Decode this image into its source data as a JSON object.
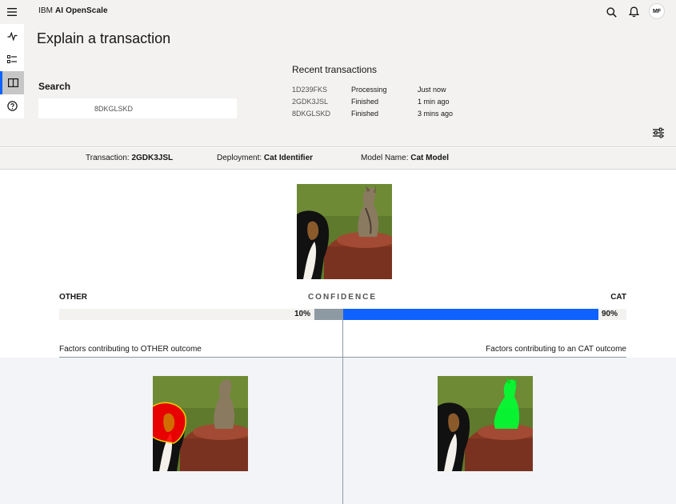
{
  "header": {
    "brand_ibm": "IBM",
    "brand_product": "AI OpenScale",
    "avatar_initials": "MF"
  },
  "page": {
    "title": "Explain a transaction"
  },
  "search": {
    "label": "Search",
    "value": "8DKGLSKD"
  },
  "recent": {
    "title": "Recent transactions",
    "rows": [
      {
        "id": "1D239FKS",
        "status": "Processing",
        "time": "Just now"
      },
      {
        "id": "2GDK3JSL",
        "status": "Finished",
        "time": "1 min ago"
      },
      {
        "id": "8DKGLSKD",
        "status": "Finished",
        "time": "3 mins ago"
      }
    ]
  },
  "info": {
    "transaction_label": "Transaction:",
    "transaction_value": "2GDK3JSL",
    "deployment_label": "Deployment:",
    "deployment_value": "Cat Identifier",
    "model_label": "Model Name:",
    "model_value": "Cat Model"
  },
  "confidence": {
    "left_label": "OTHER",
    "center_label": "CONFIDENCE",
    "right_label": "CAT",
    "other_pct_text": "10%",
    "cat_pct_text": "90%",
    "other_fraction": 0.1,
    "cat_fraction": 0.9,
    "other_color": "#8d9aa3",
    "cat_color": "#0f62fe"
  },
  "factors": {
    "left": "Factors contributing to OTHER outcome",
    "right": "Factors contributing to an CAT outcome",
    "other_highlight_color": "#ff0000",
    "cat_highlight_color": "#00ff33"
  },
  "icons": {
    "menu": "menu-icon",
    "search": "search-icon",
    "notification": "notification-icon",
    "rail": [
      "activity-icon",
      "list-checked-icon",
      "explain-icon",
      "help-icon"
    ],
    "filter": "settings-adjust-icon"
  }
}
